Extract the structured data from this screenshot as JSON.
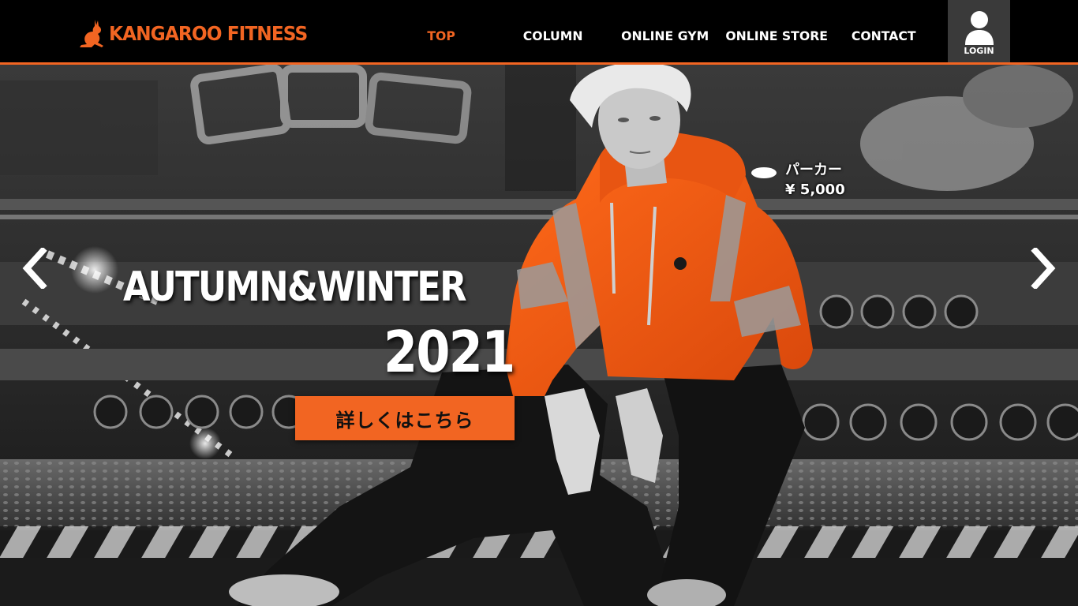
{
  "brand": {
    "name": "KANGAROO FITNESS",
    "accent_color": "#f26522",
    "logo_icon": "kangaroo-icon"
  },
  "nav": {
    "items": [
      {
        "label": "TOP",
        "active": true
      },
      {
        "label": "COLUMN",
        "active": false
      },
      {
        "label": "ONLINE GYM",
        "active": false
      },
      {
        "label": "ONLINE STORE",
        "active": false
      },
      {
        "label": "CONTACT",
        "active": false
      }
    ],
    "login": {
      "label": "LOGIN",
      "icon": "user-icon"
    }
  },
  "hero": {
    "headline": "AUTUMN&WINTER",
    "year": "2021",
    "cta_label": "詳しくはこちら",
    "product": {
      "name": "パーカー",
      "price": "¥ 5,000"
    },
    "prev_icon": "chevron-left-icon",
    "next_icon": "chevron-right-icon"
  }
}
